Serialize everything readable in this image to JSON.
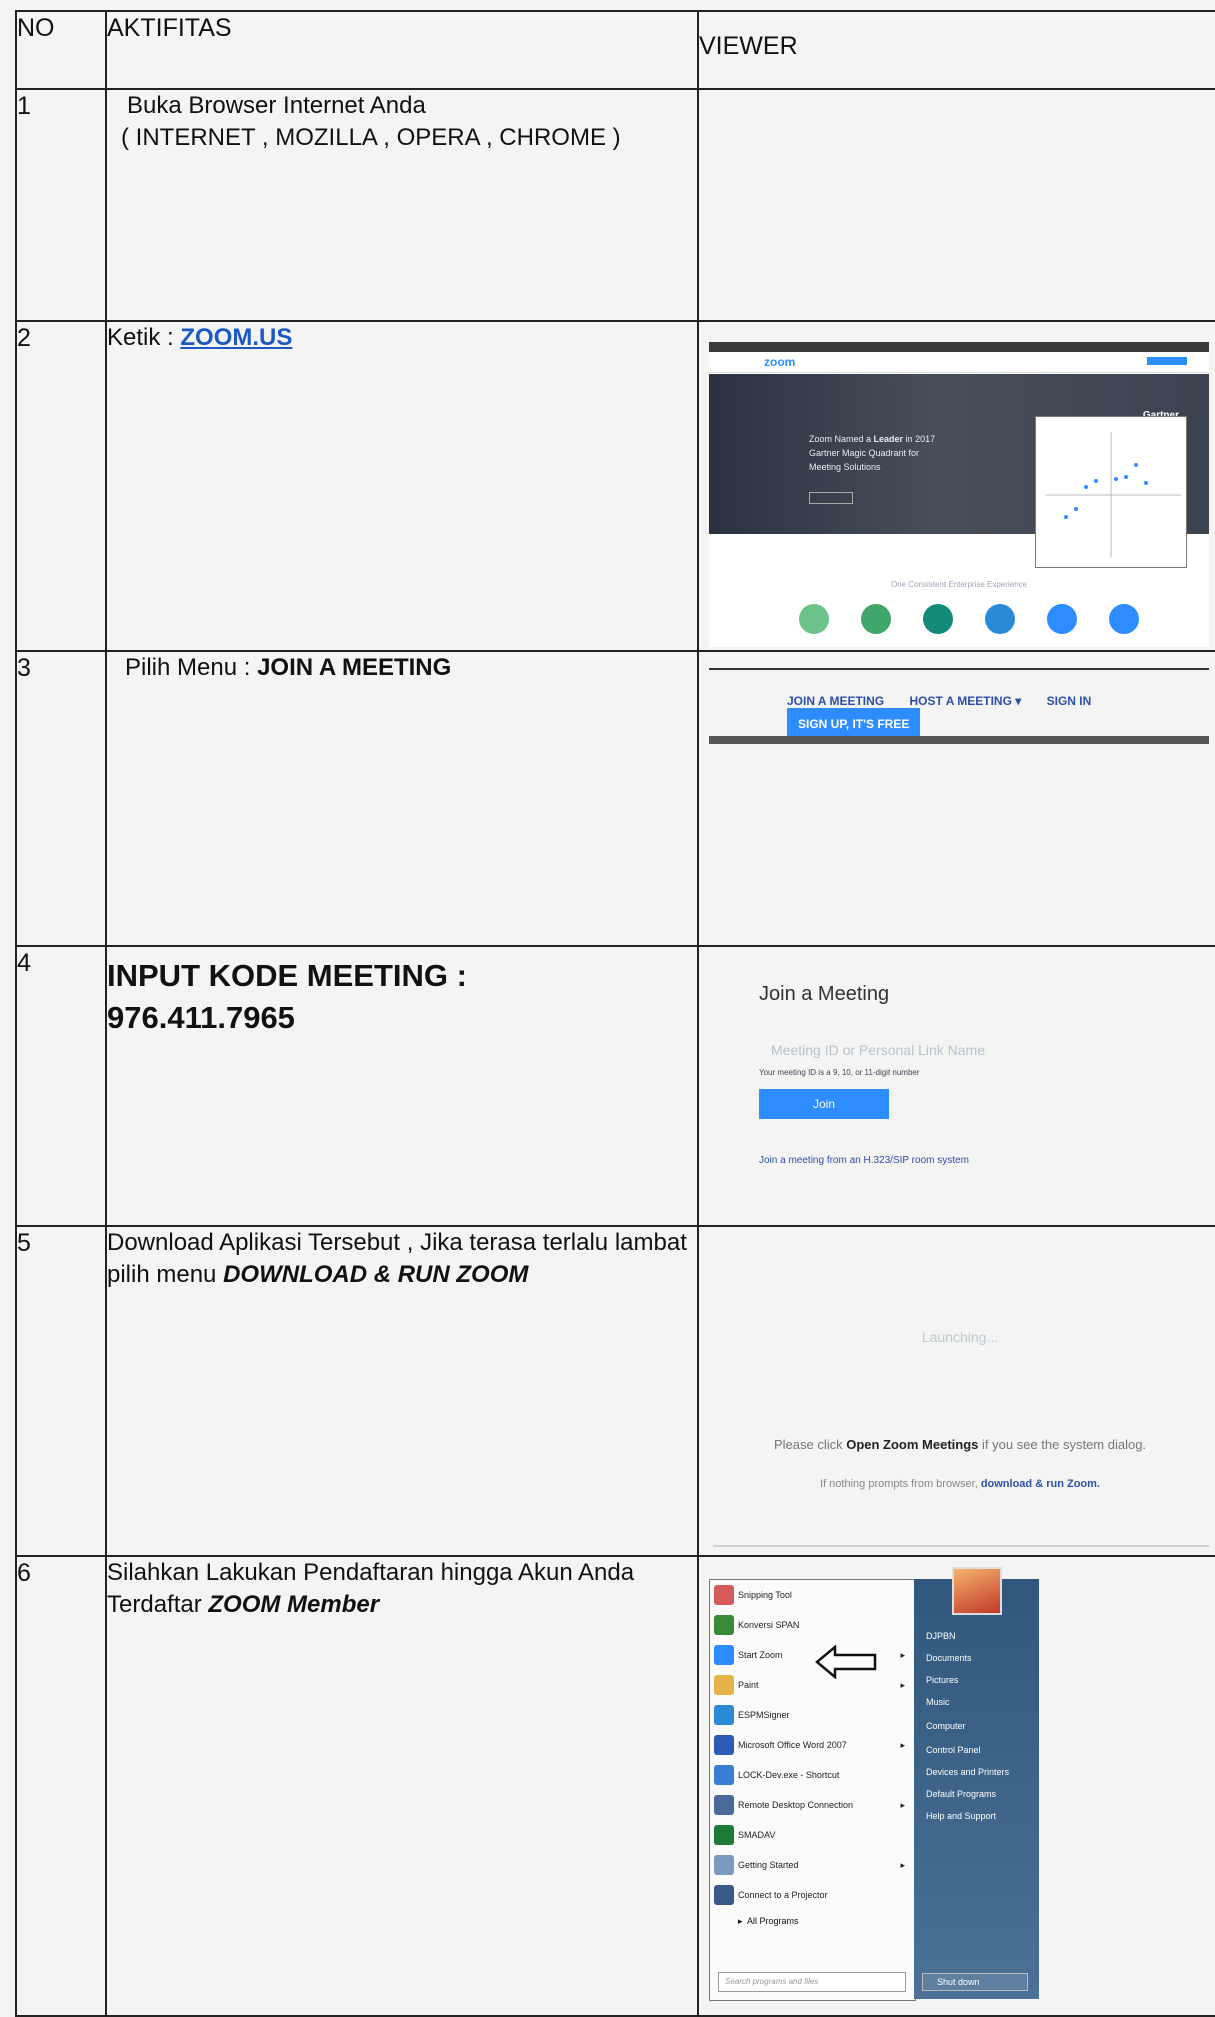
{
  "table": {
    "headers": {
      "no": "NO",
      "activity": "AKTIFITAS",
      "viewer": "VIEWER"
    },
    "rows": [
      {
        "no": "1",
        "line1": "Buka Browser Internet Anda",
        "line2": "( INTERNET , MOZILLA , OPERA , CHROME )"
      },
      {
        "no": "2",
        "prefix": "Ketik :",
        "link": "ZOOM.US"
      },
      {
        "no": "3",
        "prefix": "Pilih Menu :",
        "bold": "JOIN A MEETING"
      },
      {
        "no": "4",
        "line1": "INPUT KODE MEETING :",
        "line2": "976.411.7965"
      },
      {
        "no": "5",
        "text": "Download Aplikasi Tersebut , Jika terasa terlalu lambat pilih menu",
        "emph": "DOWNLOAD & RUN ZOOM"
      },
      {
        "no": "6",
        "text": "Silahkan Lakukan Pendaftaran hingga Akun Anda Terdaftar",
        "emph": "ZOOM Member"
      }
    ]
  },
  "viewer2": {
    "logo": "zoom",
    "hero_line1": "Zoom Named a",
    "hero_bold": "Leader",
    "hero_line2": "in 2017 Gartner Magic Quadrant for Meeting Solutions",
    "gartner": "Gartner",
    "subtitle": "One Consistent Enterprise Experience",
    "icon_colors": [
      "#6cc38a",
      "#3fa66c",
      "#148a7a",
      "#2a8ad6",
      "#2d8cff",
      "#2d8cff"
    ]
  },
  "viewer3": {
    "join": "JOIN A MEETING",
    "host": "HOST A MEETING ▾",
    "signin": "SIGN IN",
    "signup": "SIGN UP, IT'S FREE"
  },
  "viewer4": {
    "title": "Join a Meeting",
    "placeholder": "Meeting ID or Personal Link Name",
    "hint": "Your meeting ID is a 9, 10, or 11-digit number",
    "button": "Join",
    "h323": "Join a meeting from an H.323/SIP room system"
  },
  "viewer5": {
    "launching": "Launching...",
    "please_pre": "Please click",
    "please_bold": "Open Zoom Meetings",
    "please_post": "if you see the system dialog.",
    "nothing_pre": "If nothing prompts from browser,",
    "nothing_link": "download & run Zoom."
  },
  "viewer6": {
    "left_items": [
      {
        "label": "Snipping Tool",
        "color": "#d65a5a",
        "arrow": false
      },
      {
        "label": "Konversi SPAN",
        "color": "#3a8a3a",
        "arrow": false
      },
      {
        "label": "Start Zoom",
        "color": "#2d8cff",
        "arrow": true
      },
      {
        "label": "Paint",
        "color": "#e6b34a",
        "arrow": true
      },
      {
        "label": "ESPMSigner",
        "color": "#2a8ad6",
        "arrow": false
      },
      {
        "label": "Microsoft Office Word 2007",
        "color": "#2b5bb5",
        "arrow": true
      },
      {
        "label": "LOCK-Dev.exe - Shortcut",
        "color": "#3a7fd6",
        "arrow": false
      },
      {
        "label": "Remote Desktop Connection",
        "color": "#4a6a9a",
        "arrow": true
      },
      {
        "label": "SMADAV",
        "color": "#1f7a3a",
        "arrow": false
      },
      {
        "label": "Getting Started",
        "color": "#7a9ac0",
        "arrow": true
      },
      {
        "label": "Connect to a Projector",
        "color": "#3a5a8a",
        "arrow": false
      }
    ],
    "all_programs": "All Programs",
    "search": "Search programs and files",
    "right_items": [
      "DJPBN",
      "Documents",
      "Pictures",
      "Music",
      "Computer",
      "Control Panel",
      "Devices and Printers",
      "Default Programs",
      "Help and Support"
    ],
    "shutdown": "Shut down"
  }
}
